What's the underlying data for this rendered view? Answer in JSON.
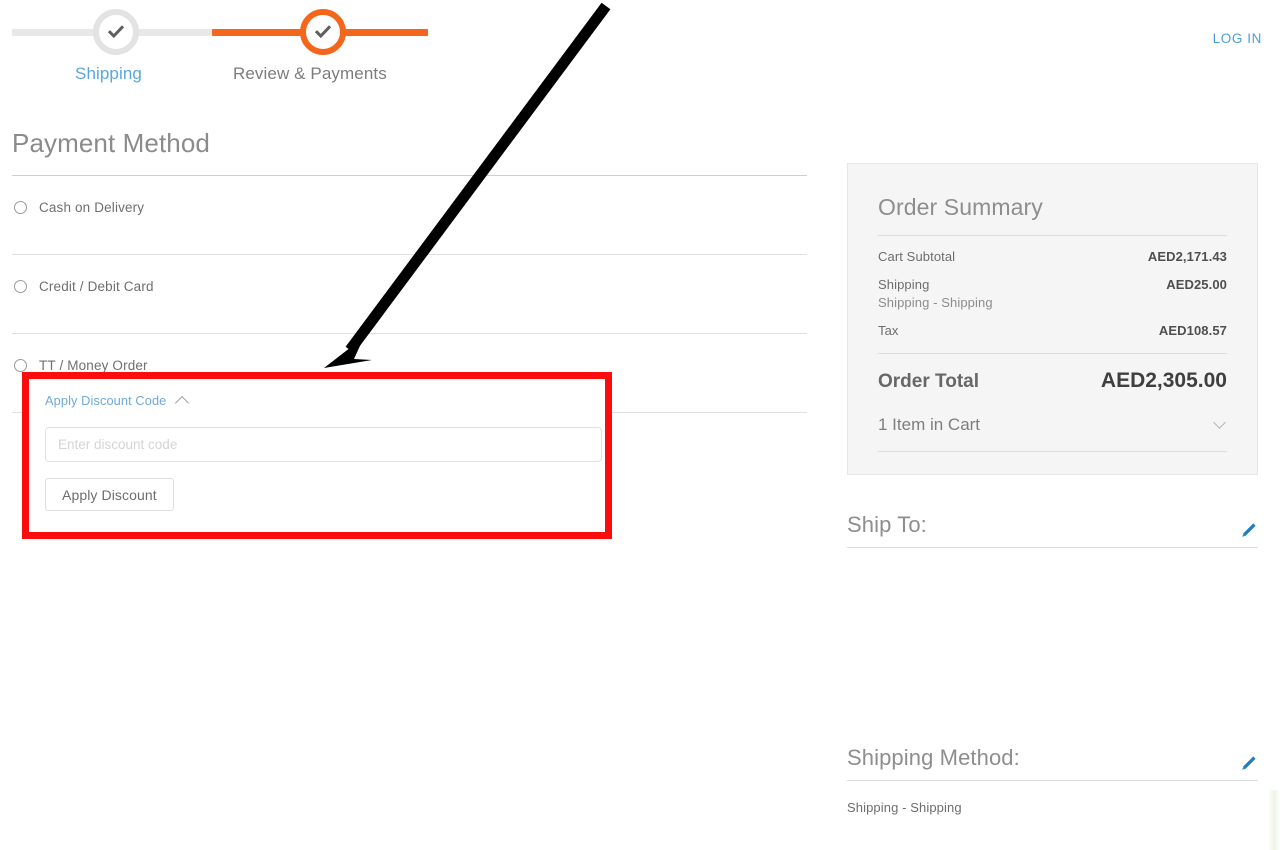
{
  "header": {
    "login_label": "LOG IN"
  },
  "progress": {
    "steps": [
      {
        "label": "Shipping",
        "state": "complete",
        "icon": "check-icon"
      },
      {
        "label": "Review & Payments",
        "state": "active",
        "icon": "check-icon"
      }
    ],
    "active_color": "#f4661b",
    "complete_color": "#e3e3e3",
    "shipping_label_color": "#5aa7de"
  },
  "payment": {
    "title": "Payment Method",
    "options": [
      {
        "label": "Cash on Delivery",
        "selected": false
      },
      {
        "label": "Credit / Debit Card",
        "selected": false
      },
      {
        "label": "TT / Money Order",
        "selected": false
      }
    ]
  },
  "discount": {
    "toggle_label": "Apply Discount Code",
    "toggle_icon": "chevron-up-icon",
    "input_placeholder": "Enter discount code",
    "input_value": "",
    "button_label": "Apply Discount",
    "highlight_color": "#fc0d0d"
  },
  "annotation": {
    "arrow_color": "#000000",
    "points_to": "discount-code-section"
  },
  "order_summary": {
    "title": "Order Summary",
    "rows": [
      {
        "label": "Cart Subtotal",
        "value": "AED2,171.43",
        "sub": ""
      },
      {
        "label": "Shipping",
        "value": "AED25.00",
        "sub": "Shipping - Shipping"
      },
      {
        "label": "Tax",
        "value": "AED108.57",
        "sub": ""
      }
    ],
    "total_label": "Order Total",
    "total_value": "AED2,305.00",
    "cart_items_label": "1 Item in Cart",
    "cart_items_icon": "chevron-down-icon"
  },
  "ship_to": {
    "title": "Ship To:",
    "edit_icon": "pencil-icon",
    "body": ""
  },
  "shipping_method": {
    "title": "Shipping Method:",
    "edit_icon": "pencil-icon",
    "body": "Shipping - Shipping"
  }
}
